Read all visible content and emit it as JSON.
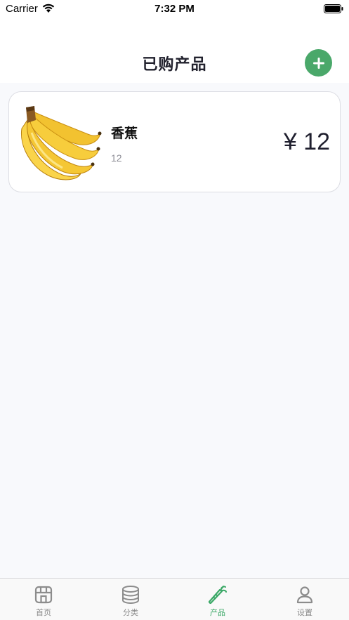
{
  "status_bar": {
    "carrier": "Carrier",
    "time": "7:32 PM",
    "wifi_icon": "wifi-icon",
    "battery_icon": "battery-icon"
  },
  "header": {
    "title": "已购产品",
    "add_icon": "plus-icon",
    "accent_color": "#4aa86a"
  },
  "products": [
    {
      "name": "香蕉",
      "quantity": "12",
      "price": "¥ 12",
      "image": "banana-image"
    }
  ],
  "tab_bar": {
    "active_color": "#3aa866",
    "inactive_color": "#8c8c8c",
    "tabs": [
      {
        "label": "首页",
        "icon": "store-icon",
        "active": false
      },
      {
        "label": "分类",
        "icon": "database-icon",
        "active": false
      },
      {
        "label": "产品",
        "icon": "carrot-icon",
        "active": true
      },
      {
        "label": "设置",
        "icon": "user-icon",
        "active": false
      }
    ]
  }
}
